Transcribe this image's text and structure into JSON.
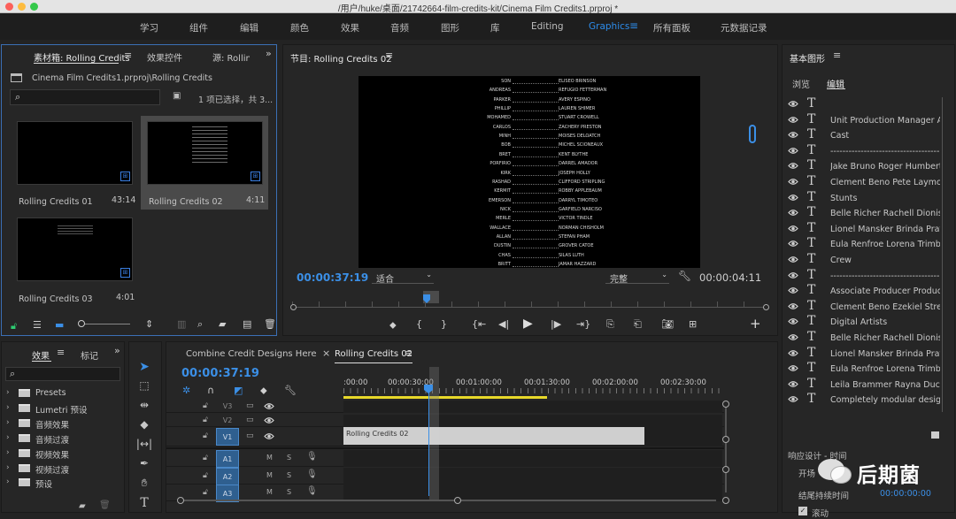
{
  "window": {
    "title": "/用户/huke/桌面/21742664-film-credits-kit/Cinema Film Credits1.prproj *"
  },
  "menu": {
    "items": [
      "学习",
      "组件",
      "编辑",
      "颜色",
      "效果",
      "音频",
      "图形",
      "库",
      "Editing",
      "Graphics",
      "所有面板",
      "元数据记录"
    ],
    "active": "Graphics"
  },
  "project": {
    "tabs": [
      "素材箱: Rolling Credits",
      "效果控件",
      "源: Rolling"
    ],
    "path": "Cinema Film Credits1.prproj\\Rolling Credits",
    "search_placeholder": "",
    "selection_status": "1 项已选择，共 3...",
    "items": [
      {
        "name": "Rolling Credits 01",
        "duration": "43:14"
      },
      {
        "name": "Rolling Credits 02",
        "duration": "4:11"
      },
      {
        "name": "Rolling Credits 03",
        "duration": "4:01"
      }
    ]
  },
  "program": {
    "title": "节目: Rolling Credits 02",
    "timecode": "00:00:37:19",
    "fit": "适合",
    "quality": "完整",
    "duration": "00:00:04:11",
    "credits": [
      [
        "SON",
        "ELISEO BRINSON"
      ],
      [
        "ANDREAS",
        "REFUGIO FETTERMAN"
      ],
      [
        "PARKER",
        "AVERY ESPINO"
      ],
      [
        "PHILLIP",
        "LAUREN SHIMER"
      ],
      [
        "MOHAMED",
        "STUART CROWELL"
      ],
      [
        "CARLOS",
        "ZACHERY PRESTON"
      ],
      [
        "MINH",
        "MOISES DELOATCH"
      ],
      [
        "BOB",
        "MICHEL SCIONEAUX"
      ],
      [
        "BRET",
        "KENT BLYTHE"
      ],
      [
        "PORFIRIO",
        "DARREL AMADOR"
      ],
      [
        "KIRK",
        "JOSEPH HOLLY"
      ],
      [
        "RASHAD",
        "CLIFFORD STRIPLING"
      ],
      [
        "KERMIT",
        "ROBBY APPLEBAUM"
      ],
      [
        "EMERSON",
        "DARRYL TIMOTEO"
      ],
      [
        "NICK",
        "GARFIELD NARCISO"
      ],
      [
        "MERLE",
        "VICTOR TINDLE"
      ],
      [
        "WALLACE",
        "NORMAN CHISHOLM"
      ],
      [
        "ALLAN",
        "STEFAN PHAM"
      ],
      [
        "DUSTIN",
        "GROVER CATOE"
      ],
      [
        "CHAS",
        "SILAS LUTH"
      ],
      [
        "BRITT",
        "JAMAR HAZZARD"
      ]
    ]
  },
  "essential_graphics": {
    "title": "基本图形",
    "tabs": [
      "浏览",
      "编辑"
    ],
    "layers": [
      "",
      "Unit Production Manager A...",
      "Cast",
      "------------------------------------",
      "Jake Bruno Roger Humberto...",
      "Clement Beno Pete Laymon...",
      "Stunts",
      "Belle Richer Rachell Dionisio...",
      "Lionel Mansker Brinda Prath...",
      "Eula Renfroe Lorena Trimble...",
      "Crew",
      "------------------------------------",
      "Associate Producer Product...",
      "Clement Beno  Ezekiel Streb...",
      "Digital Artists",
      "Belle Richer Rachell Dionisio...",
      "Lionel Mansker Brinda Prath...",
      "Eula Renfroe Lorena Trimble...",
      "Leila Brammer Rayna Duch...",
      "Completely modular design..."
    ],
    "responsive": "响应设计 - 时间",
    "start": "开场",
    "end_duration": "结尾持续时间",
    "end_value": "00:00:00:00",
    "scroll": "滚动"
  },
  "effects": {
    "tabs": [
      "效果",
      "标记"
    ],
    "search_placeholder": "",
    "folders": [
      "Presets",
      "Lumetri 预设",
      "音频效果",
      "音频过渡",
      "视频效果",
      "视频过渡",
      "预设"
    ]
  },
  "timeline": {
    "tabs": [
      "Combine Credit Designs Here",
      "Rolling Credits 02"
    ],
    "timecode": "00:00:37:19",
    "ruler": [
      ":00:00",
      "00:00:30:00",
      "00:01:00:00",
      "00:01:30:00",
      "00:02:00:00",
      "00:02:30:00"
    ],
    "tracks": [
      "V3",
      "V2",
      "V1",
      "A1",
      "A2",
      "A3"
    ],
    "clip": "Rolling Credits 02",
    "track_buttons": [
      "M",
      "S"
    ]
  },
  "watermark": {
    "text": "后期菌"
  },
  "colors": {
    "accent": "#2d8ceb",
    "playhead": "#3b8fe6",
    "clip": "#cfcfcf",
    "work_area": "#e8d82a"
  }
}
